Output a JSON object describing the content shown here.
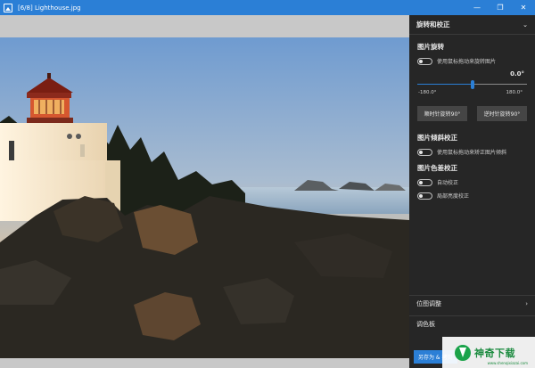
{
  "window": {
    "title": "[6/8]   Lighthouse.jpg",
    "controls": {
      "minimize": "—",
      "restore": "❐",
      "close": "✕"
    }
  },
  "panel": {
    "header": {
      "title": "旋转和校正",
      "chevron": "⌄"
    },
    "rotate": {
      "title": "图片旋转",
      "toggle_label": "使用鼠标拖动来旋转图片",
      "angle": "0.0°",
      "slider": {
        "min_label": "-180.0°",
        "max_label": "180.0°",
        "value_fraction": 0.5
      },
      "cw_button": "顺时针旋转90°",
      "ccw_button": "逆时针旋转90°"
    },
    "tilt": {
      "title": "图片倾斜校正",
      "toggle_label": "使用鼠标拖动来矫正图片倾斜"
    },
    "color": {
      "title": "图片色差校正",
      "auto_label": "自动校正",
      "local_label": "局部亮度校正"
    },
    "bottom": {
      "bitmap": {
        "label": "位图调整",
        "chevron": "›"
      },
      "palette": {
        "label": "调色板"
      },
      "save_label": "另存为 & 拷贝"
    }
  },
  "watermark": {
    "text": "神奇下载",
    "sub": "www.shenqixiazai.com"
  },
  "colors": {
    "accent": "#2b7fd6",
    "panel": "#262626",
    "button": "#454545"
  }
}
